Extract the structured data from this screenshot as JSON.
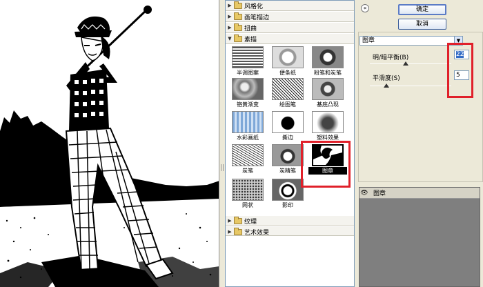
{
  "gallery": {
    "categories_top": [
      {
        "label": "风格化",
        "expanded": false
      },
      {
        "label": "画笔描边",
        "expanded": false
      },
      {
        "label": "扭曲",
        "expanded": false
      },
      {
        "label": "素描",
        "expanded": true
      }
    ],
    "thumbnails": [
      {
        "label": "半调图案"
      },
      {
        "label": "便条纸"
      },
      {
        "label": "粉笔和炭笔"
      },
      {
        "label": "铬黄渐变"
      },
      {
        "label": "绘图笔"
      },
      {
        "label": "基底凸现"
      },
      {
        "label": "水彩画纸"
      },
      {
        "label": "撕边"
      },
      {
        "label": "塑料效果"
      },
      {
        "label": "炭笔"
      },
      {
        "label": "炭精笔"
      },
      {
        "label": "图章",
        "selected": true
      },
      {
        "label": "网状"
      },
      {
        "label": "影印"
      }
    ],
    "categories_bottom": [
      {
        "label": "纹理",
        "expanded": false
      },
      {
        "label": "艺术效果",
        "expanded": false
      }
    ]
  },
  "dialog": {
    "ok_label": "确定",
    "cancel_label": "取消",
    "filter_select_value": "图章",
    "params": [
      {
        "label": "明/暗平衡(B)",
        "value": "22",
        "fraction": 0.44
      },
      {
        "label": "平滑度(S)",
        "value": "5",
        "fraction": 0.2
      }
    ]
  },
  "layers": {
    "items": [
      {
        "label": "图章"
      }
    ]
  },
  "colors": {
    "highlight": "#e0202a",
    "selection": "#316ac5"
  }
}
